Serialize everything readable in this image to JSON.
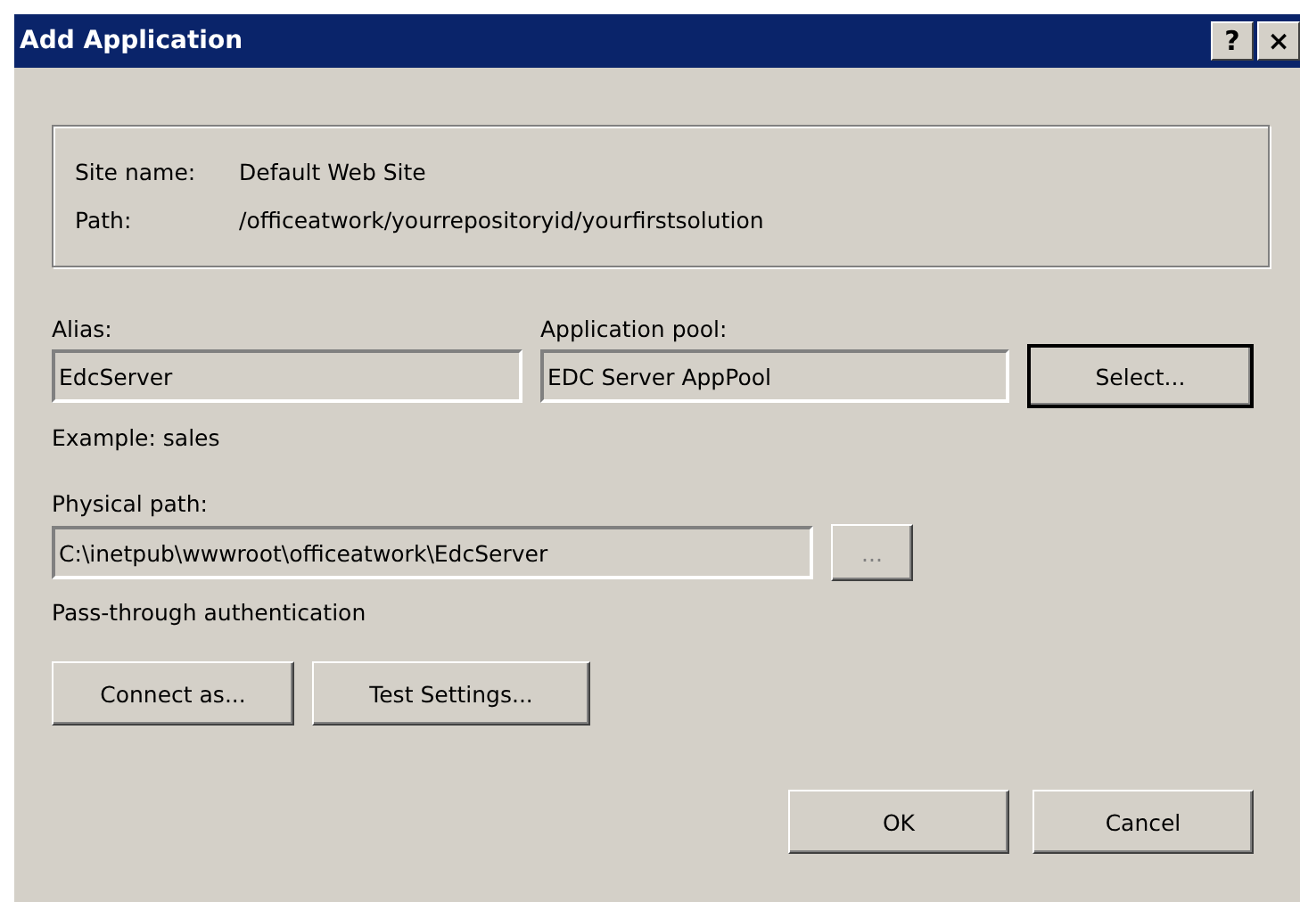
{
  "window": {
    "title": "Add Application",
    "title_buttons": [
      "?",
      "×"
    ]
  },
  "site_info": [
    {
      "label": "Site name:",
      "value": "Default Web Site"
    },
    {
      "label": "Path:",
      "value": "/officeatwork/yourrepositoryid/yourfirstsolution"
    }
  ],
  "alias": {
    "label": "Alias:",
    "value": "EdcServer",
    "hint": "Example: sales"
  },
  "application_pool": {
    "label": "Application pool:",
    "value": "EDC Server AppPool",
    "button": {
      "label": "Select...",
      "default": true
    }
  },
  "physical_path": {
    "label": "Physical path:",
    "value": "C:\\inetpub\\wwwroot\\officeatwork\\EdcServer",
    "browse": {
      "label": "...",
      "disabled": true
    }
  },
  "authentication": "Pass-through authentication",
  "actions": [
    {
      "label": "Connect as..."
    },
    {
      "label": "Test Settings..."
    }
  ],
  "buttons": [
    {
      "label": "OK",
      "default": false
    },
    {
      "label": "Cancel",
      "default": false
    }
  ]
}
